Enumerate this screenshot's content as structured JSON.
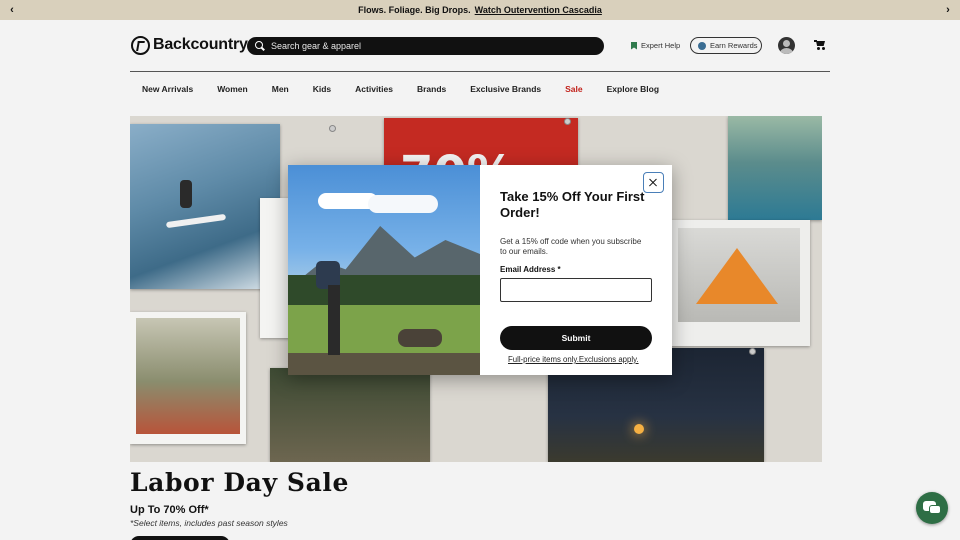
{
  "promo": {
    "text": "Flows. Foliage. Big Drops.",
    "link": "Watch Outervention Cascadia",
    "prev_icon": "chevron-left-icon",
    "next_icon": "chevron-right-icon"
  },
  "header": {
    "logo_text": "Backcountry",
    "search_placeholder": "Search gear & apparel",
    "expert_help": "Expert Help",
    "earn_rewards": "Earn Rewards",
    "account_icon": "account-icon",
    "cart_icon": "cart-icon"
  },
  "nav": {
    "items": [
      "New Arrivals",
      "Women",
      "Men",
      "Kids",
      "Activities",
      "Brands",
      "Exclusive Brands",
      "Sale",
      "Explore Blog"
    ]
  },
  "modal": {
    "title": "Take 15% Off Your First Order!",
    "description": "Get a 15% off code when you subscribe to our emails.",
    "email_label": "Email Address *",
    "email_value": "",
    "submit": "Submit",
    "fine_print": "Full-price items only.Exclusions apply."
  },
  "sale": {
    "title": "Labor Day Sale",
    "subtitle": "Up To 70% Off*",
    "note": "*Select items, includes past season styles"
  },
  "colors": {
    "promo_bg": "#d9d0bc",
    "sale_link": "#c2221b",
    "chat_button": "#2e6e45",
    "expert_icon": "#2f7a4c"
  }
}
